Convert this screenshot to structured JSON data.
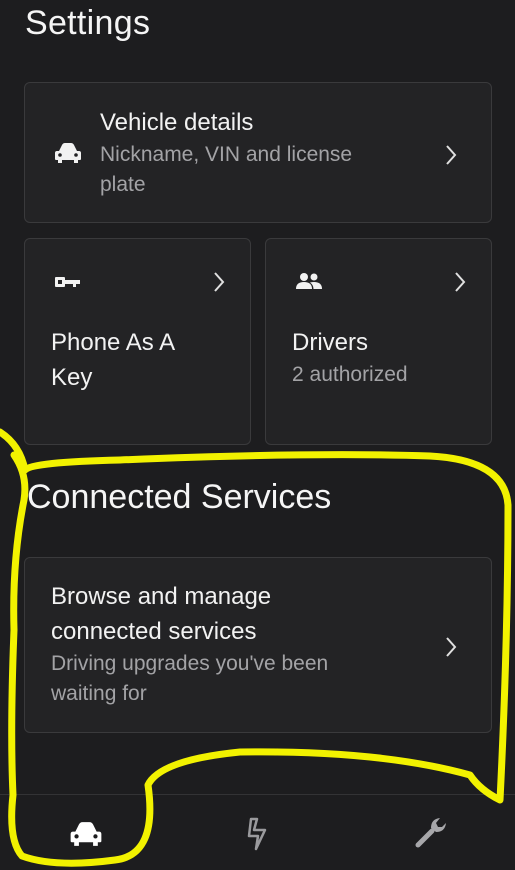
{
  "header": {
    "title": "Settings"
  },
  "vehicle_card": {
    "title": "Vehicle details",
    "subtitle_line1": "Nickname, VIN and license",
    "subtitle_line2": "plate",
    "icon": "car-icon"
  },
  "phone_key_card": {
    "title_line1": "Phone As A",
    "title_line2": "Key",
    "icon": "key-icon"
  },
  "drivers_card": {
    "title": "Drivers",
    "subtitle": "2 authorized",
    "icon": "people-icon"
  },
  "connected_services": {
    "section_title": "Connected Services",
    "card_title_line1": "Browse and manage",
    "card_title_line2": "connected services",
    "card_sub_line1": "Driving upgrades you've been",
    "card_sub_line2": "waiting for"
  },
  "tabbar": {
    "tabs": [
      {
        "icon": "car-icon",
        "active": true
      },
      {
        "icon": "lightning-icon",
        "active": false
      },
      {
        "icon": "wrench-icon",
        "active": false
      }
    ]
  },
  "colors": {
    "background": "#1d1d1f",
    "card": "#232325",
    "card_border": "#3a3a3c",
    "secondary_text": "#a3a3a6",
    "annotation": "#f2f200"
  }
}
